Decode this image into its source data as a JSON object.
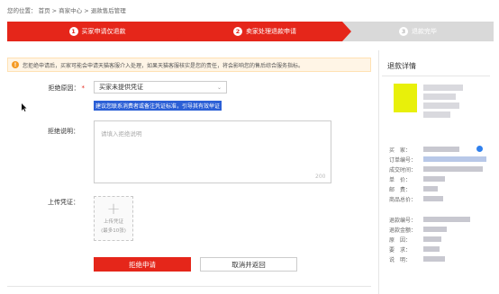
{
  "breadcrumb": "您的位置：  首页 > 商家中心 > 退款售后管理",
  "steps": [
    {
      "num": "1",
      "label": "买家申请仅退款"
    },
    {
      "num": "2",
      "label": "卖家处理退款申请"
    },
    {
      "num": "3",
      "label": "退款完毕"
    }
  ],
  "warning": {
    "icon": "!",
    "text": "您拒绝申请后，买家可能会申请天猫客服介入处理，如果天猫客服核实是您的责任，将会影响您的售后综合服务指标。"
  },
  "form": {
    "reason_label": "拒绝原因：",
    "reason_required": "*",
    "reason_value": "买家未提供凭证",
    "hint": "建议您联系消费者或备注凭证标准，引导其有效举证",
    "desc_label": "拒绝说明：",
    "desc_placeholder": "请填入拒绝说明",
    "desc_count": "200",
    "upload_label": "上传凭证：",
    "upload_text": "上传凭证",
    "upload_limit": "(最多10张)",
    "submit_label": "拒绝申请",
    "cancel_label": "取消并返回"
  },
  "detail": {
    "title": "退款详情",
    "keys": [
      "买　家：",
      "订单编号：",
      "成交时间：",
      "单　价：",
      "邮　费：",
      "商品总价：",
      "退款编号：",
      "退款金额：",
      "原　因：",
      "要　求：",
      "说　明："
    ]
  },
  "colors": {
    "accent": "#e5261a",
    "inactive_step": "#d9d9d9",
    "hint_bg": "#2b5fd6"
  }
}
